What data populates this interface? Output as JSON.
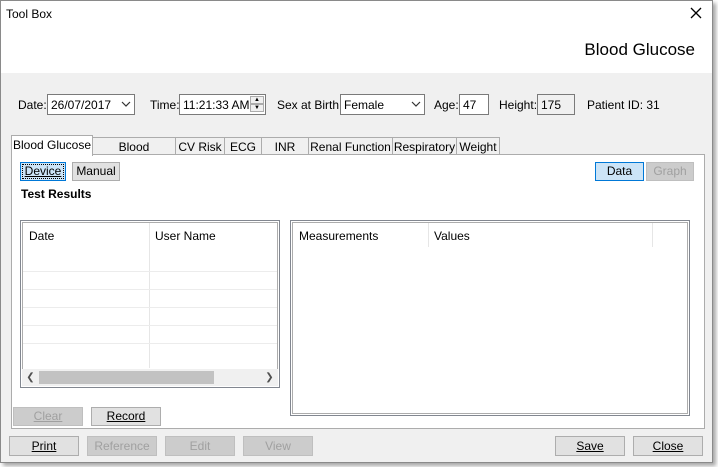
{
  "window": {
    "title": "Tool Box"
  },
  "header": {
    "title": "Blood Glucose"
  },
  "form": {
    "date_label": "Date:",
    "date_value": "26/07/2017",
    "time_label": "Time:",
    "time_value": "11:21:33 AM",
    "sex_label": "Sex at Birth:",
    "sex_value": "Female",
    "age_label": "Age:",
    "age_value": "47",
    "height_label": "Height:",
    "height_value": "175",
    "patient_label": "Patient ID: 31"
  },
  "tabs": [
    {
      "label": "Blood Glucose",
      "active": true
    },
    {
      "label": "Blood Pressure"
    },
    {
      "label": "CV Risk"
    },
    {
      "label": "ECG"
    },
    {
      "label": "INR"
    },
    {
      "label": "Renal Function"
    },
    {
      "label": "Respiratory"
    },
    {
      "label": "Weight"
    }
  ],
  "panel": {
    "device_label": "Device",
    "manual_label": "Manual",
    "data_label": "Data",
    "graph_label": "Graph",
    "section_title": "Test Results",
    "results_columns": [
      "Date",
      "User Name"
    ],
    "measure_columns": [
      "Measurements",
      "Values"
    ],
    "clear_label": "Clear",
    "record_label": "Record"
  },
  "footer": {
    "print_label": "Print",
    "reference_label": "Reference",
    "edit_label": "Edit",
    "view_label": "View",
    "save_label": "Save",
    "close_label": "Close"
  },
  "colors": {
    "accent_border": "#0078d7",
    "accent_fill": "#cce4f7"
  }
}
